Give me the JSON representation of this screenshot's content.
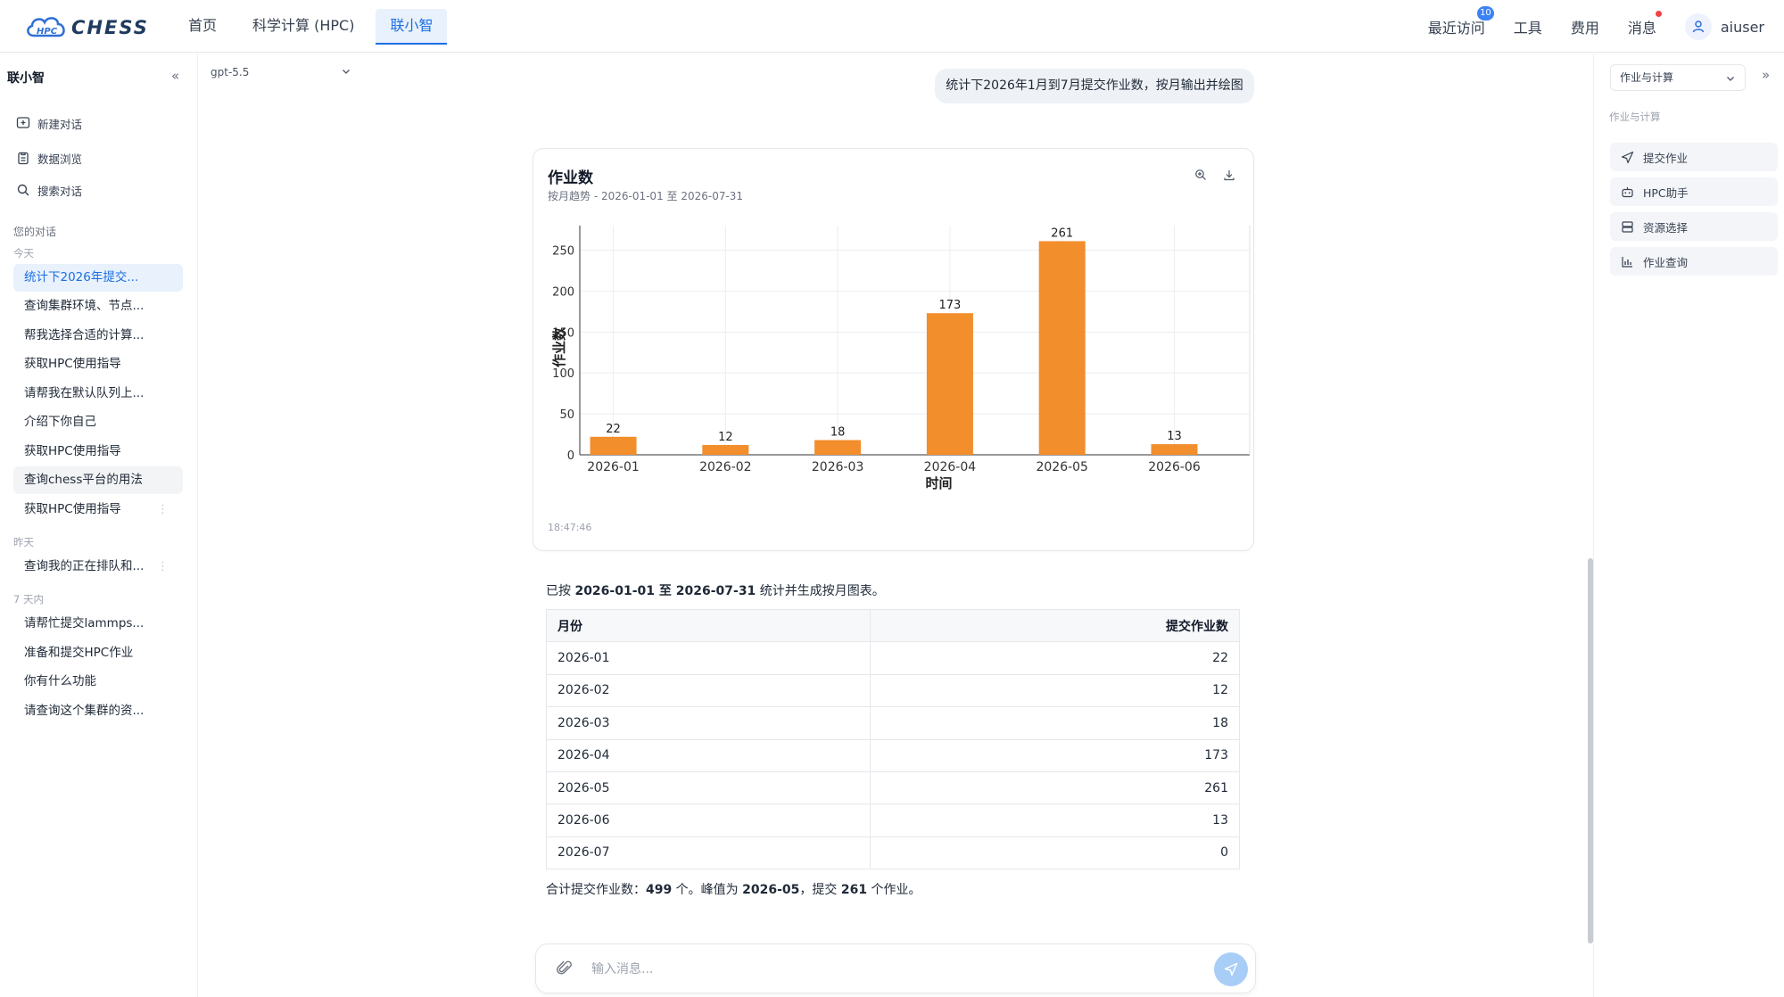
{
  "brand": {
    "logo_text": "CHESS",
    "logo_sub": "HPC"
  },
  "nav": {
    "items": [
      {
        "label": "首页"
      },
      {
        "label": "科学计算 (HPC)"
      },
      {
        "label": "联小智"
      }
    ],
    "active_index": 2
  },
  "topright": {
    "recent": "最近访问",
    "recent_badge": "10",
    "tools": "工具",
    "fees": "费用",
    "messages": "消息",
    "username": "aiuser"
  },
  "sidebar": {
    "title": "联小智",
    "collapse_icon": "«",
    "actions": [
      {
        "label": "新建对话",
        "icon": "new-chat-icon"
      },
      {
        "label": "数据浏览",
        "icon": "clipboard-icon"
      },
      {
        "label": "搜索对话",
        "icon": "search-icon"
      }
    ],
    "section_title": "您的对话",
    "groups": [
      {
        "label": "今天",
        "items": [
          "统计下2026年提交...",
          "查询集群环境、节点...",
          "帮我选择合适的计算...",
          "获取HPC使用指导",
          "请帮我在默认队列上...",
          "介绍下你自己",
          "获取HPC使用指导",
          "查询chess平台的用法",
          "获取HPC使用指导"
        ]
      },
      {
        "label": "昨天",
        "items": [
          "查询我的正在排队和..."
        ]
      },
      {
        "label": "7 天内",
        "items": [
          "请帮忙提交lammps...",
          "准备和提交HPC作业",
          "你有什么功能",
          "请查询这个集群的资..."
        ]
      }
    ]
  },
  "model_selector": {
    "value": "gpt-5.5"
  },
  "chat": {
    "user_message": "统计下2026年1月到7月提交作业数，按月输出并绘图",
    "chart_card": {
      "title": "作业数",
      "subtitle": "按月趋势 - 2026-01-01 至 2026-07-31",
      "time": "18:47:46"
    },
    "reply_prefix": "已按 ",
    "reply_range": "2026-01-01 至 2026-07-31",
    "reply_suffix": " 统计并生成按月图表。",
    "table": {
      "headers": [
        "月份",
        "提交作业数"
      ],
      "rows": [
        [
          "2026-01",
          "22"
        ],
        [
          "2026-02",
          "12"
        ],
        [
          "2026-03",
          "18"
        ],
        [
          "2026-04",
          "173"
        ],
        [
          "2026-05",
          "261"
        ],
        [
          "2026-06",
          "13"
        ],
        [
          "2026-07",
          "0"
        ]
      ]
    },
    "summary": {
      "p1": "合计提交作业数：",
      "total": "499",
      "p2": " 个。峰值为 ",
      "peak_month": "2026-05",
      "p3": "，提交 ",
      "peak_value": "261",
      "p4": " 个作业。"
    },
    "input_placeholder": "输入消息..."
  },
  "chart_data": {
    "type": "bar",
    "categories": [
      "2026-01",
      "2026-02",
      "2026-03",
      "2026-04",
      "2026-05",
      "2026-06"
    ],
    "values": [
      22,
      12,
      18,
      173,
      261,
      13
    ],
    "xlabel": "时间",
    "ylabel": "作业数",
    "yticks": [
      "0",
      "50",
      "100",
      "150",
      "200",
      "250"
    ],
    "ylim": [
      0,
      280
    ],
    "grid": true,
    "bar_color": "#f28e2b"
  },
  "right_panel": {
    "select_value": "作业与计算",
    "expand_icon": "»",
    "section_label": "作业与计算",
    "items": [
      {
        "label": "提交作业",
        "icon": "send-icon"
      },
      {
        "label": "HPC助手",
        "icon": "robot-icon"
      },
      {
        "label": "资源选择",
        "icon": "server-icon"
      },
      {
        "label": "作业查询",
        "icon": "bar-chart-icon"
      }
    ]
  },
  "colors": {
    "accent": "#1d6fe0",
    "active_bg": "#e8f1fc",
    "bar": "#f28e2b",
    "badge": "#3b82f6",
    "notify": "#ef4444"
  }
}
